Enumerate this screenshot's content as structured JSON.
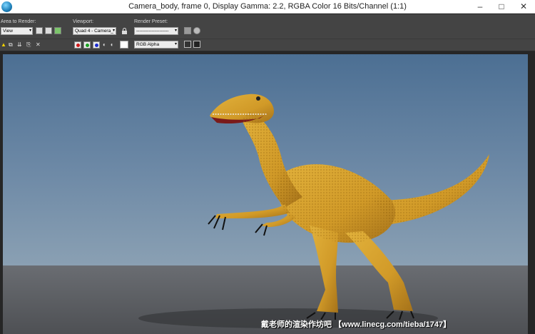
{
  "window": {
    "title": "Camera_body, frame 0, Display Gamma: 2.2, RGBA Color 16 Bits/Channel (1:1)",
    "minimize_glyph": "–",
    "maximize_glyph": "□",
    "close_glyph": "✕"
  },
  "toolbar": {
    "area_label": "Area to Render:",
    "area_value": "View",
    "viewport_label": "Viewport:",
    "viewport_value": "Quad 4 - Camera_",
    "preset_label": "Render Preset:",
    "preset_value": "---------------------",
    "channel_value": "RGB Alpha",
    "dropdown_glyph": "▾"
  },
  "icons": {
    "app": "3ds-max-icon",
    "colors": {
      "red": "#d01818",
      "green": "#18a020",
      "blue": "#1a2ad0"
    }
  },
  "watermark": "戴老师的渲染作坊吧 【www.linecg.com/tieba/1747】"
}
